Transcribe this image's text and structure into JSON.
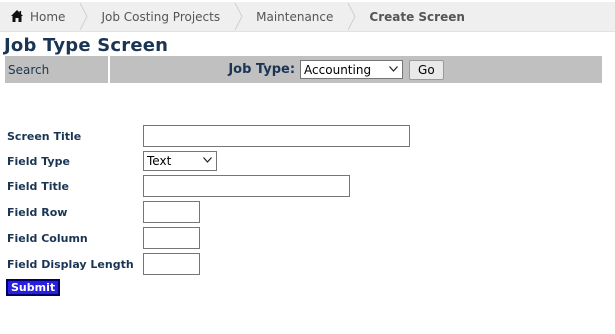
{
  "breadcrumb": {
    "home": "Home",
    "items": [
      "Job Costing Projects",
      "Maintenance"
    ],
    "current": "Create Screen"
  },
  "page_title": "Job Type Screen",
  "toolbar": {
    "search_label": "Search",
    "job_type_label": "Job Type:",
    "job_type_value": "Accounting",
    "go_label": "Go"
  },
  "form": {
    "screen_title_label": "Screen Title",
    "screen_title_value": "",
    "field_type_label": "Field Type",
    "field_type_value": "Text",
    "field_title_label": "Field Title",
    "field_title_value": "",
    "field_row_label": "Field Row",
    "field_row_value": "",
    "field_column_label": "Field Column",
    "field_column_value": "",
    "field_display_length_label": "Field Display Length",
    "field_display_length_value": "",
    "submit_label": "Submit"
  },
  "icons": {
    "home": "home-icon",
    "chevron": "chevron-down-icon"
  }
}
